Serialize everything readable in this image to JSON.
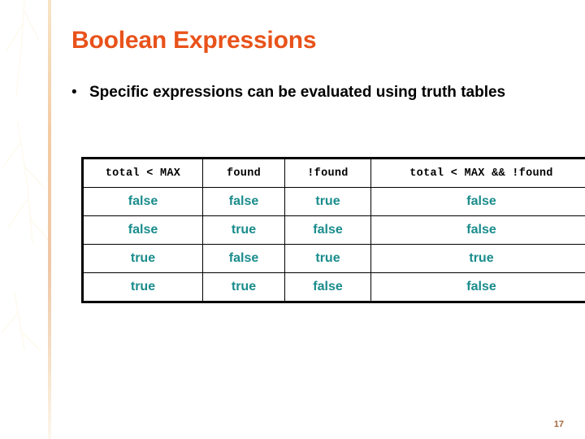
{
  "slide": {
    "title": "Boolean Expressions",
    "bullet_marker": "•",
    "bullet_text": "Specific expressions can be evaluated using truth tables",
    "page_number": "17"
  },
  "colors": {
    "title": "#e8521a",
    "table_value": "#1a8c8c",
    "table_header": "#000000",
    "body_text": "#000000",
    "page_number": "#a5673f",
    "background": "#ffffff"
  },
  "chart_data": {
    "type": "table",
    "title": "",
    "columns": [
      "total < MAX",
      "found",
      "!found",
      "total < MAX && !found"
    ],
    "rows": [
      [
        "false",
        "false",
        "true",
        "false"
      ],
      [
        "false",
        "true",
        "false",
        "false"
      ],
      [
        "true",
        "false",
        "true",
        "true"
      ],
      [
        "true",
        "true",
        "false",
        "false"
      ]
    ]
  },
  "decoration": {
    "sidebar_image": "autumn-maple-leaves"
  }
}
